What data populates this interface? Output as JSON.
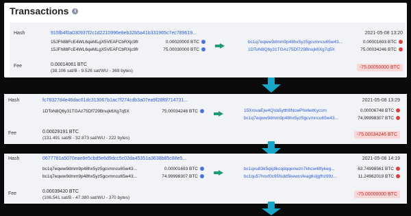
{
  "title": "Transactions",
  "transactions": [
    {
      "hash_label": "Hash",
      "hash": "915fb4f0a030937f2c1d2210996e8eb32b5a41b331965c7ec789619...",
      "date": "2021-05-08 13:20",
      "inputs": [
        {
          "address": "15JFh88FcE4WL6qeMLgX5VEAFCbRXjc9fr",
          "amount": "0.00020000 BTC"
        },
        {
          "address": "15JFh88FcE4WL6qeMLgX5VEAFCbRXjc9fr",
          "amount": "75.00030000 BTC"
        }
      ],
      "outputs": [
        {
          "address": "bc1q7eqww9dmm9p48hx5yz5gcvmncu65w43...",
          "amount": "0.00001693 BTC"
        },
        {
          "address": "1DToN8Q6y31TGAz75Df729Bnujk6Xg7q5X",
          "amount": "75.00034246 BTC"
        }
      ],
      "fee_label": "Fee",
      "fee": "0.00014061 BTC",
      "fee_detail": "(38.106 sat/B - 9.526 sat/WU - 369 bytes)",
      "total": "-75.00050000 BTC"
    },
    {
      "hash_label": "Hash",
      "hash": "fc78327d4e46dac01dc313067b1ac7f274cdb3a07ea9f28f6f714731...",
      "date": "2021-05-08 13:29",
      "inputs": [
        {
          "address": "1DToN8Q6y31TGAz75Df729Bnujk6Xg7q5X",
          "amount": "75.00034246 BTC"
        }
      ],
      "outputs": [
        {
          "address": "15XrovaEjw4QVa5ytth9NcwPhx6etKycsm",
          "amount": "0.00006748 BTC"
        },
        {
          "address": "bc1q7eqww9dmm9p48hx5yz5gcvmncu65w43...",
          "amount": "74.99998307 BTC"
        }
      ],
      "fee_label": "Fee",
      "fee": "0.00029191 BTC",
      "fee_detail": "(131.491 sat/B - 32.873 sat/WU - 222 bytes)",
      "total": "-75.00034246 BTC"
    },
    {
      "hash_label": "Hash",
      "hash": "0677781a5070eae8e5cbd5e6d9dcc5c02da45351a3638b85c88e5...",
      "date": "2021-05-08 14:19",
      "inputs": [
        {
          "address": "bc1q7eqww9dmm9p48hx5yz5gcvmncu65w43...",
          "amount": "0.00001693 BTC"
        },
        {
          "address": "bc1q7eqww9dmm9p48hx5yz5gcvmncu65w43...",
          "amount": "74.99998307 BTC"
        }
      ],
      "outputs": [
        {
          "address": "bc1qxu83k5qkj8kcqdqqenwzn7khcw4llfykeg...",
          "amount": "63.74998561 BTC"
        },
        {
          "address": "bc1qu57hnxf0c65fsdd5kewcsfeag6sljgfhz99z...",
          "amount": "11.24962019 BTC"
        }
      ],
      "fee_label": "Fee",
      "fee": "0.00039420 BTC",
      "fee_detail": "(106.541 sat/B - 47.380 sat/WU - 370 bytes)",
      "total": "-75.00000000 BTC"
    }
  ],
  "colors": {
    "accent_blue": "#2a5bd7",
    "arrow_green": "#1e9b76",
    "flow_arrow": "#19a7c9",
    "negative": "#c62828"
  },
  "icons": {
    "info": "info-icon",
    "input_globe": "globe-icon-blue",
    "output_globe": "globe-icon-red",
    "flow": "arrow-right-icon",
    "chain": "arrow-down-icon"
  }
}
